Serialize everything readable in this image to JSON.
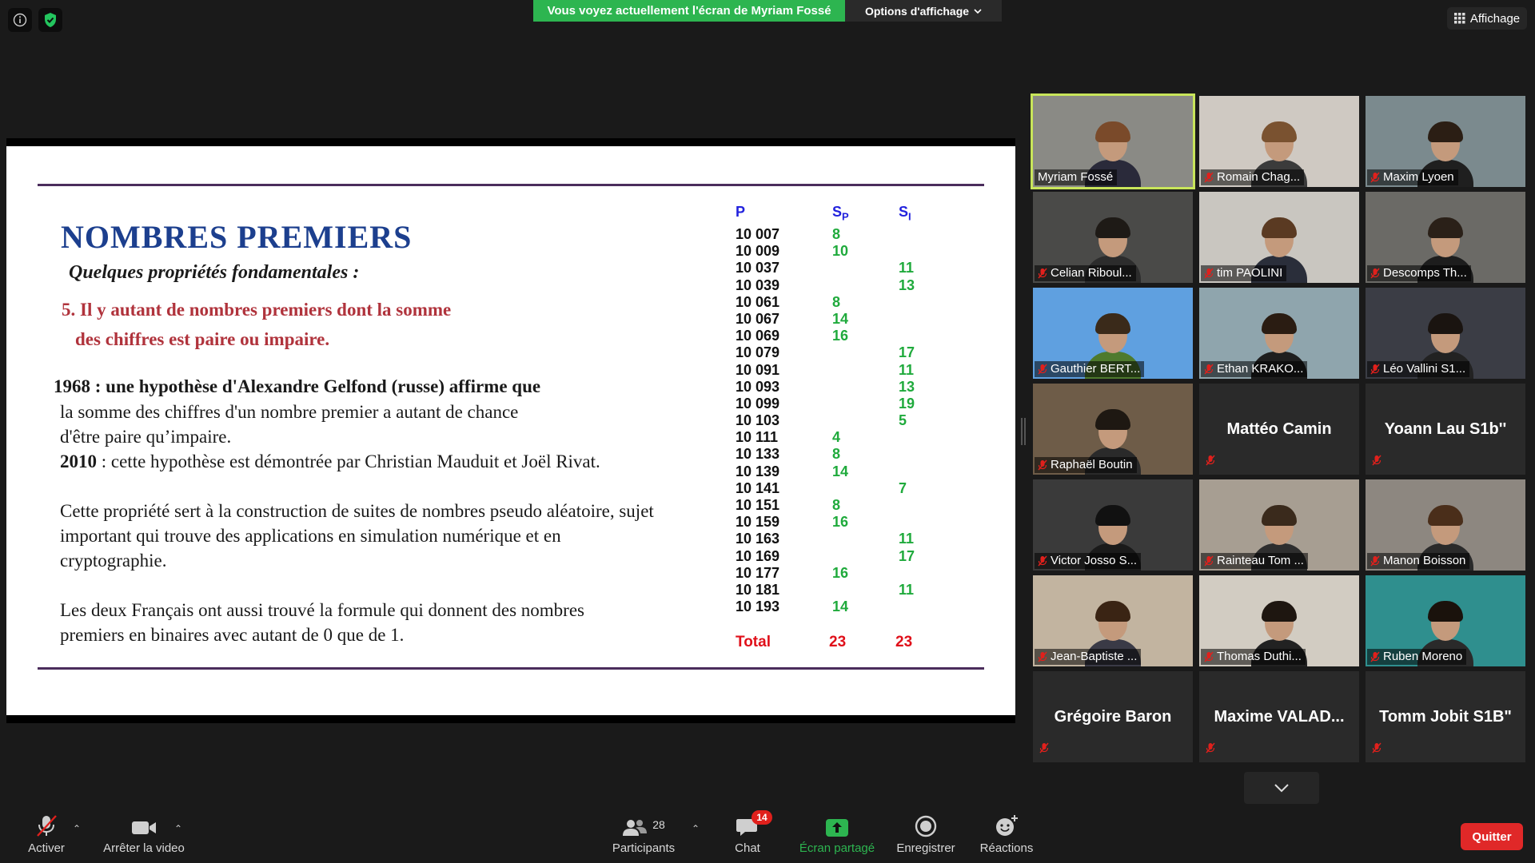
{
  "top": {
    "sharing_banner": "Vous voyez actuellement l'écran de Myriam Fossé",
    "view_options": "Options d'affichage",
    "view_button": "Affichage",
    "accent_green": "#2db550"
  },
  "slide": {
    "title": "NOMBRES PREMIERS",
    "subtitle": "Quelques propriétés fondamentales :",
    "property_line1": "5. Il y autant de nombres premiers dont la somme",
    "property_line2": "des chiffres est paire ou impaire.",
    "hyp_year": "1968 :",
    "hyp_text": "une hypothèse d'Alexandre Gelfond (russe) affirme que",
    "hyp_line2": "la somme des chiffres d'un nombre premier a autant de chance",
    "hyp_line3": "d'être paire qu’impaire.",
    "proof_year": "2010",
    "proof_text": " : cette hypothèse est démontrée par Christian Mauduit et Joël Rivat.",
    "usage_line1": "Cette propriété sert à la construction de suites de nombres pseudo aléatoire, sujet",
    "usage_line2": "important qui trouve des applications en simulation numérique et en",
    "usage_line3": "cryptographie.",
    "binary_line1": "Les deux Français ont aussi trouvé la formule qui donnent des nombres",
    "binary_line2": "premiers en binaires avec autant de 0 que de 1.",
    "table": {
      "header_p": "P",
      "header_sp": "S",
      "header_sp_sub": "P",
      "header_si": "S",
      "header_si_sub": "I",
      "rows": [
        {
          "p": "10 007",
          "sp": "8",
          "si": ""
        },
        {
          "p": "10 009",
          "sp": "10",
          "si": ""
        },
        {
          "p": "10 037",
          "sp": "",
          "si": "11"
        },
        {
          "p": "10 039",
          "sp": "",
          "si": "13"
        },
        {
          "p": "10 061",
          "sp": "8",
          "si": ""
        },
        {
          "p": "10 067",
          "sp": "14",
          "si": ""
        },
        {
          "p": "10 069",
          "sp": "16",
          "si": ""
        },
        {
          "p": "10 079",
          "sp": "",
          "si": "17"
        },
        {
          "p": "10 091",
          "sp": "",
          "si": "11"
        },
        {
          "p": "10 093",
          "sp": "",
          "si": "13"
        },
        {
          "p": "10 099",
          "sp": "",
          "si": "19"
        },
        {
          "p": "10 103",
          "sp": "",
          "si": "5"
        },
        {
          "p": "10 111",
          "sp": "4",
          "si": ""
        },
        {
          "p": "10 133",
          "sp": "8",
          "si": ""
        },
        {
          "p": "10 139",
          "sp": "14",
          "si": ""
        },
        {
          "p": "10 141",
          "sp": "",
          "si": "7"
        },
        {
          "p": "10 151",
          "sp": "8",
          "si": ""
        },
        {
          "p": "10 159",
          "sp": "16",
          "si": ""
        },
        {
          "p": "10 163",
          "sp": "",
          "si": "11"
        },
        {
          "p": "10 169",
          "sp": "",
          "si": "17"
        },
        {
          "p": "10 177",
          "sp": "16",
          "si": ""
        },
        {
          "p": "10 181",
          "sp": "",
          "si": "11"
        },
        {
          "p": "10 193",
          "sp": "14",
          "si": ""
        }
      ],
      "total_label": "Total",
      "total_sp": "23",
      "total_si": "23"
    }
  },
  "participants": [
    {
      "name": "Myriam Fossé",
      "video": true,
      "active": true,
      "muted": false,
      "bg": "#8a8a85",
      "shirt": "#2a2a3a",
      "hair": "#7a4a2a"
    },
    {
      "name": "Romain Chag...",
      "video": true,
      "muted": true,
      "bg": "#cfc9c2",
      "shirt": "#3b3b3b",
      "hair": "#7a5230"
    },
    {
      "name": "Maxim Lyoen",
      "video": true,
      "muted": true,
      "bg": "#7b8a8e",
      "shirt": "#1f1f1f",
      "hair": "#2b1e14"
    },
    {
      "name": "Celian Riboul...",
      "video": true,
      "muted": true,
      "bg": "#4a4a48",
      "shirt": "#2c2c2c",
      "hair": "#1e1a16"
    },
    {
      "name": "tim PAOLINI",
      "video": true,
      "muted": true,
      "bg": "#c9c6c0",
      "shirt": "#2a2e3a",
      "hair": "#5a3a22"
    },
    {
      "name": "Descomps Th...",
      "video": true,
      "muted": true,
      "bg": "#6b6a66",
      "shirt": "#1d1d1d",
      "hair": "#2a2018"
    },
    {
      "name": "Gauthier BERT...",
      "video": true,
      "muted": true,
      "bg": "#5fa0e0",
      "shirt": "#4e7a2e",
      "hair": "#3a2a1a"
    },
    {
      "name": "Ethan KRAKO...",
      "video": true,
      "muted": true,
      "bg": "#8fa5ad",
      "shirt": "#1e1e1e",
      "hair": "#2a1c12"
    },
    {
      "name": "Léo Vallini S1...",
      "video": true,
      "muted": true,
      "bg": "#3b3d45",
      "shirt": "#222",
      "hair": "#1a1410"
    },
    {
      "name": "Raphaël Boutin",
      "video": true,
      "muted": true,
      "bg": "#6e5c48",
      "shirt": "#2a2a2a",
      "hair": "#1e1812"
    },
    {
      "name": "Mattéo Camin",
      "video": false,
      "muted": true
    },
    {
      "name": "Yoann Lau S1b''",
      "video": false,
      "muted": true
    },
    {
      "name": "Victor Josso S...",
      "video": true,
      "muted": true,
      "bg": "#3a3a3a",
      "shirt": "#1a1a1a",
      "hair": "#111"
    },
    {
      "name": "Rainteau Tom ...",
      "video": true,
      "muted": true,
      "bg": "#a79e92",
      "shirt": "#2e2e2e",
      "hair": "#3a2a1c"
    },
    {
      "name": "Manon Boisson",
      "video": true,
      "muted": true,
      "bg": "#8d8780",
      "shirt": "#2a2a2a",
      "hair": "#4a2e1a"
    },
    {
      "name": "Jean-Baptiste ...",
      "video": true,
      "muted": true,
      "bg": "#c2b4a0",
      "shirt": "#3a3a46",
      "hair": "#3a2414"
    },
    {
      "name": "Thomas Duthi...",
      "video": true,
      "muted": true,
      "bg": "#d2ccc2",
      "shirt": "#222",
      "hair": "#1e1610"
    },
    {
      "name": "Ruben Moreno",
      "video": true,
      "muted": true,
      "bg": "#2f8f8e",
      "shirt": "#2a2a2a",
      "hair": "#1a120c"
    },
    {
      "name": "Grégoire Baron",
      "video": false,
      "muted": true
    },
    {
      "name": "Maxime  VALAD...",
      "video": false,
      "muted": true
    },
    {
      "name": "Tomm Jobit S1B\"",
      "video": false,
      "muted": true
    }
  ],
  "toolbar": {
    "unmute_label": "Activer",
    "video_label": "Arrêter la video",
    "participants_label": "Participants",
    "participants_count": "28",
    "chat_label": "Chat",
    "chat_badge": "14",
    "share_label": "Écran partagé",
    "record_label": "Enregistrer",
    "reactions_label": "Réactions",
    "quit_label": "Quitter",
    "share_color": "#2db550",
    "quit_color": "#e02828"
  }
}
